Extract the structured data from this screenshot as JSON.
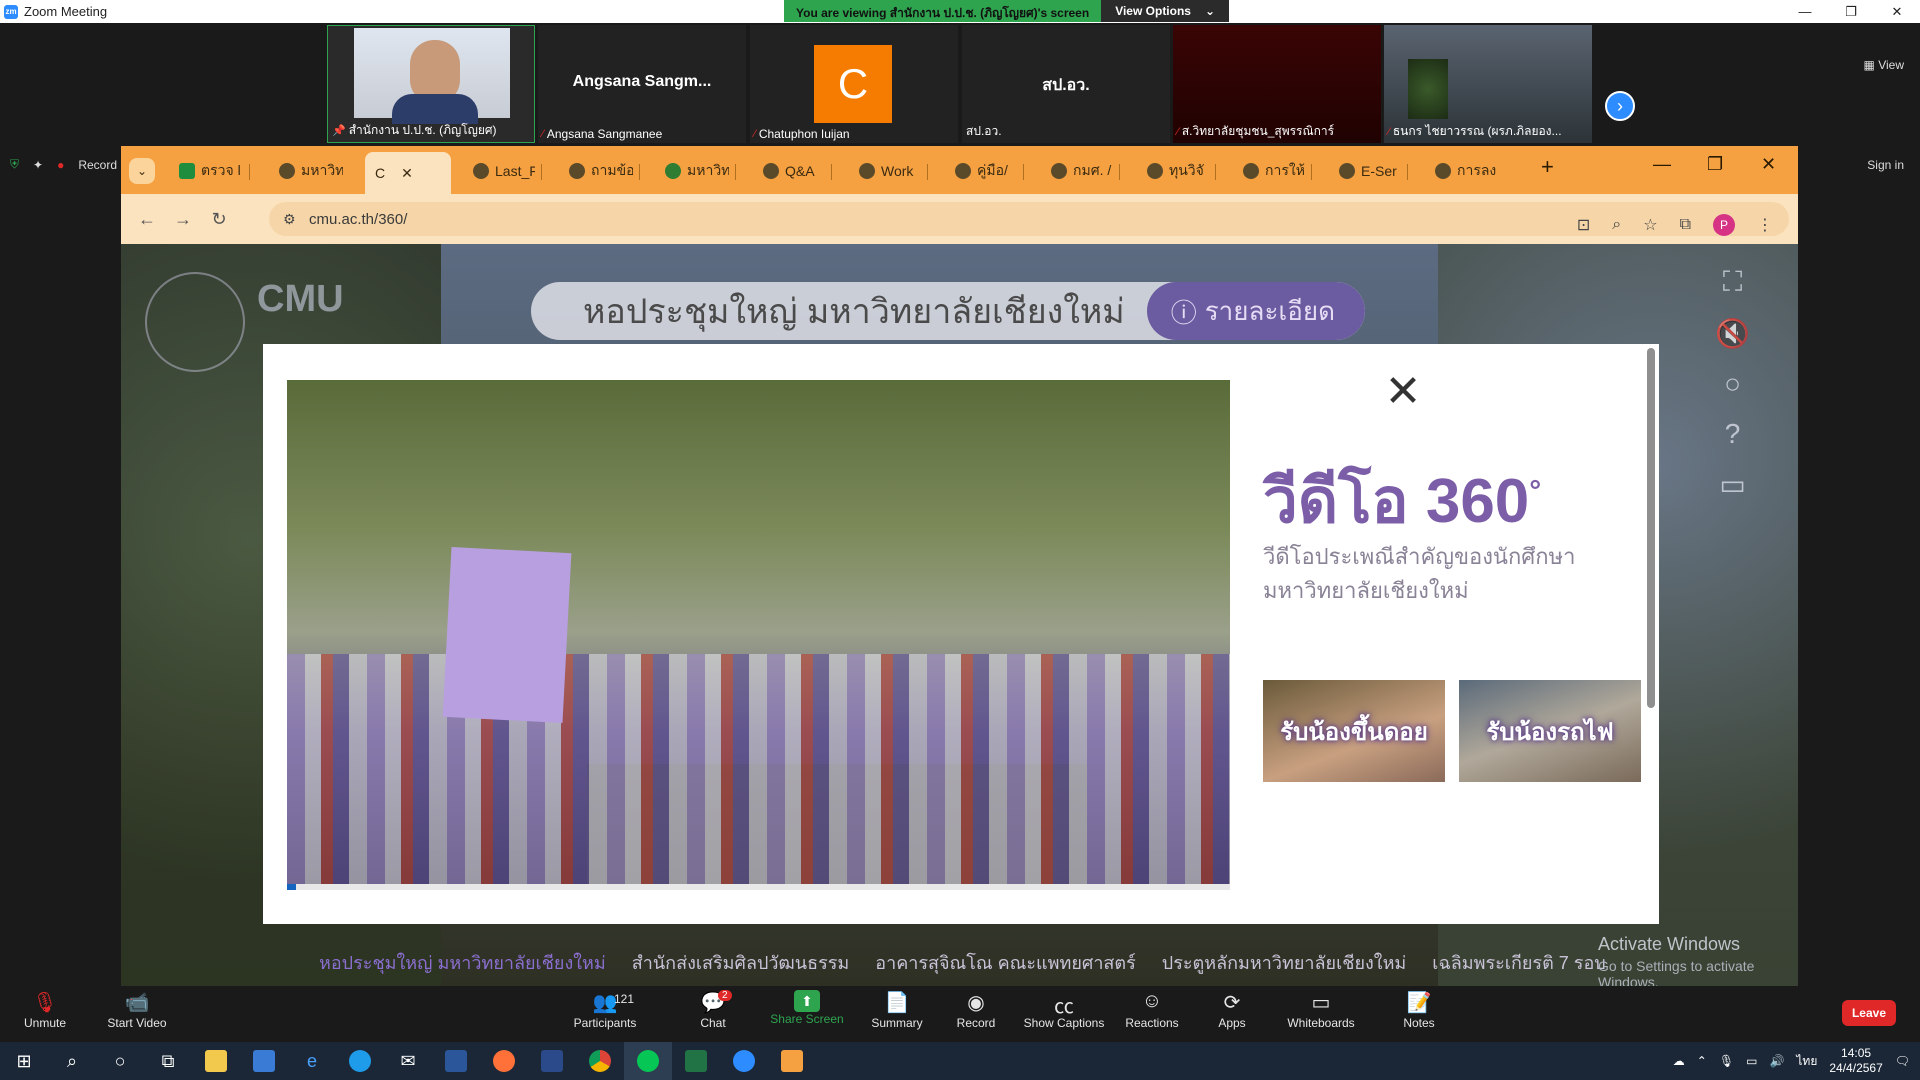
{
  "zoom": {
    "window_title": "Zoom Meeting",
    "share_banner": "You are viewing สำนักงาน ป.ป.ช. (ภิญโญยศ)'s screen",
    "view_options": "View Options",
    "view_button": "View",
    "sign_in": "Sign in",
    "recording": "Record"
  },
  "participants": [
    {
      "name": "สำนักงาน ป.ป.ช. (ภิญโญยศ)",
      "big": ""
    },
    {
      "name": "Angsana Sangmanee",
      "big": "Angsana Sangm..."
    },
    {
      "name": "Chatuphon Iuijan",
      "big": "C"
    },
    {
      "name": "สป.อว.",
      "big": "สป.อว."
    },
    {
      "name": "ส.วิทยาลัยชุมชน_สุพรรณิการ์",
      "big": ""
    },
    {
      "name": "ธนกร ไชยาวรรณ (ผรภ.ภิลยอง...",
      "big": ""
    }
  ],
  "browser": {
    "tabs": [
      "ตรวจ l",
      "มหาวิท",
      "C",
      "Last_F",
      "ถามข้อ",
      "มหาวิท",
      "Q&A",
      "Work",
      "คู่มือ/",
      "กมศ. /",
      "ทุนวิจั",
      "การให้",
      "E-Ser",
      "การลง"
    ],
    "url": "cmu.ac.th/360/",
    "profile_initial": "P"
  },
  "page": {
    "logo_text": "CMU",
    "venue_title": "หอประชุมใหญ่ มหาวิทยาลัยเชียงใหม่",
    "details_button": "รายละเอียด",
    "locations": [
      "หอประชุมใหญ่ มหาวิทยาลัยเชียงใหม่",
      "สำนักส่งเสริมศิลปวัฒนธรรม",
      "อาคารสุจิณโณ คณะแพทยศาสตร์",
      "ประตูหลักมหาวิทยาลัยเชียงใหม่",
      "เฉลิมพระเกียรติ 7 รอบ"
    ],
    "activate_title": "Activate Windows",
    "activate_sub": "Go to Settings to activate Windows."
  },
  "modal": {
    "title": "วีดีโอ 360",
    "description": "วีดีโอประเพณีสำคัญของนักศึกษามหาวิทยาลัยเชียงใหม่",
    "thumb1": "รับน้องขึ้นดอย",
    "thumb2": "รับน้องรถไฟ",
    "video_progress": 0.01
  },
  "toolbar": {
    "unmute": "Unmute",
    "start_video": "Start Video",
    "participants": "Participants",
    "participant_count": "121",
    "chat": "Chat",
    "chat_badge": "2",
    "share_screen": "Share Screen",
    "summary": "Summary",
    "record": "Record",
    "show_captions": "Show Captions",
    "reactions": "Reactions",
    "apps": "Apps",
    "whiteboards": "Whiteboards",
    "notes": "Notes",
    "leave": "Leave"
  },
  "taskbar": {
    "time": "14:05",
    "date": "24/4/2567",
    "lang": "ไทย"
  }
}
